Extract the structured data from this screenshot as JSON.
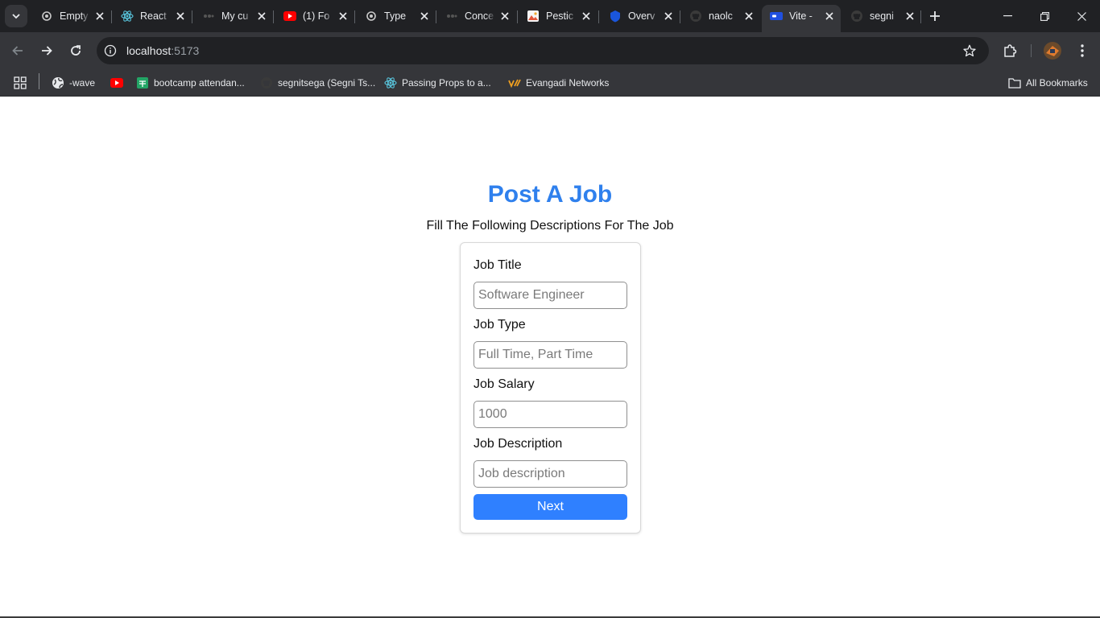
{
  "browser": {
    "tabs": [
      {
        "label": "Empty",
        "icon": "openai-icon"
      },
      {
        "label": "React",
        "icon": "react-icon"
      },
      {
        "label": "My cu",
        "icon": "page-icon"
      },
      {
        "label": "(1) Fo",
        "icon": "youtube-icon"
      },
      {
        "label": "Type",
        "icon": "openai-icon"
      },
      {
        "label": "Conce",
        "icon": "page-icon"
      },
      {
        "label": "Pestic",
        "icon": "image-icon"
      },
      {
        "label": "Overv",
        "icon": "shield-icon"
      },
      {
        "label": "naolc",
        "icon": "github-icon"
      },
      {
        "label": "Vite -",
        "icon": "vite-icon",
        "active": true
      },
      {
        "label": "segni",
        "icon": "github-icon"
      }
    ],
    "url": {
      "host": "localhost",
      "port": ":5173"
    },
    "bookmarks": [
      {
        "label": "-wave",
        "icon": "globe-icon"
      },
      {
        "label": "",
        "icon": "youtube-icon"
      },
      {
        "label": "bootcamp attendan...",
        "icon": "sheets-icon"
      },
      {
        "label": "segnitsega (Segni Ts...",
        "icon": "github-icon"
      },
      {
        "label": "Passing Props to a...",
        "icon": "react-icon"
      },
      {
        "label": "Evangadi Networks",
        "icon": "evangadi-icon"
      }
    ],
    "all_bookmarks_label": "All Bookmarks"
  },
  "page": {
    "title": "Post A Job",
    "subtitle": "Fill The Following Descriptions For The Job",
    "form": {
      "fields": [
        {
          "label": "Job Title",
          "placeholder": "Software Engineer",
          "value": ""
        },
        {
          "label": "Job Type",
          "placeholder": "Full Time, Part Time",
          "value": ""
        },
        {
          "label": "Job Salary",
          "placeholder": "1000",
          "value": ""
        },
        {
          "label": "Job Description",
          "placeholder": "Job description",
          "value": ""
        }
      ],
      "submit_label": "Next"
    }
  },
  "colors": {
    "accent": "#2f80ed",
    "button": "#2f80ff",
    "chrome_dark": "#202124",
    "chrome_toolbar": "#35363a"
  }
}
